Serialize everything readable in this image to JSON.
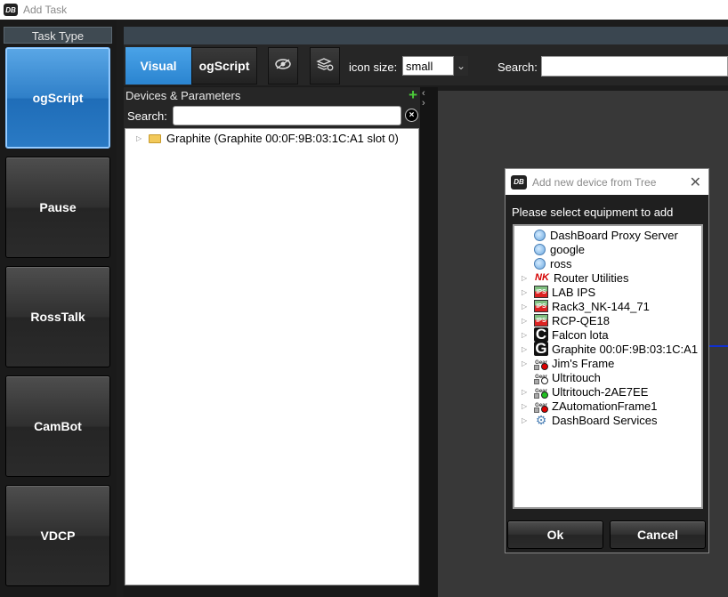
{
  "window": {
    "title": "Add Task"
  },
  "tasktype": {
    "header": "Task Type",
    "buttons": [
      {
        "label": "ogScript",
        "active": true
      },
      {
        "label": "Pause",
        "active": false
      },
      {
        "label": "RossTalk",
        "active": false
      },
      {
        "label": "CamBot",
        "active": false
      },
      {
        "label": "VDCP",
        "active": false
      }
    ]
  },
  "toolbar": {
    "visual": "Visual",
    "ogscript": "ogScript",
    "icon_size_label": "icon size:",
    "icon_size_value": "small",
    "search_label": "Search:",
    "search_value": ""
  },
  "devices": {
    "header": "Devices & Parameters",
    "search_label": "Search:",
    "search_value": "",
    "tree": [
      {
        "label": "Graphite (Graphite 00:0F:9B:03:1C:A1 slot 0)"
      }
    ]
  },
  "dialog": {
    "title": "Add new device from Tree",
    "prompt": "Please select equipment to add",
    "items": [
      {
        "label": "DashBoard Proxy Server",
        "icon": "globe-icon",
        "expandable": false
      },
      {
        "label": "google",
        "icon": "globe-icon",
        "expandable": false
      },
      {
        "label": "ross",
        "icon": "globe-icon",
        "expandable": false
      },
      {
        "label": "Router Utilities",
        "icon": "nk-icon",
        "expandable": true
      },
      {
        "label": "LAB IPS",
        "icon": "ips-icon",
        "expandable": true
      },
      {
        "label": "Rack3_NK-144_71",
        "icon": "ips-icon",
        "expandable": true
      },
      {
        "label": "RCP-QE18",
        "icon": "ips-icon",
        "expandable": true
      },
      {
        "label": "Falcon lota",
        "icon": "c-logo-icon",
        "expandable": true
      },
      {
        "label": "Graphite 00:0F:9B:03:1C:A1",
        "icon": "g-logo-icon",
        "expandable": true
      },
      {
        "label": "Jim's Frame",
        "icon": "gear-red-icon",
        "expandable": true
      },
      {
        "label": "Ultritouch",
        "icon": "gear-white-icon",
        "expandable": false
      },
      {
        "label": "Ultritouch-2AE7EE",
        "icon": "gear-green-icon",
        "expandable": true
      },
      {
        "label": "ZAutomationFrame1",
        "icon": "gear-red-icon",
        "expandable": true
      },
      {
        "label": "DashBoard Services",
        "icon": "cog-icon",
        "expandable": true
      }
    ],
    "ok": "Ok",
    "cancel": "Cancel"
  },
  "colors": {
    "accent": "#2a84d0",
    "status_red": "#e00000",
    "status_green": "#20c020"
  }
}
